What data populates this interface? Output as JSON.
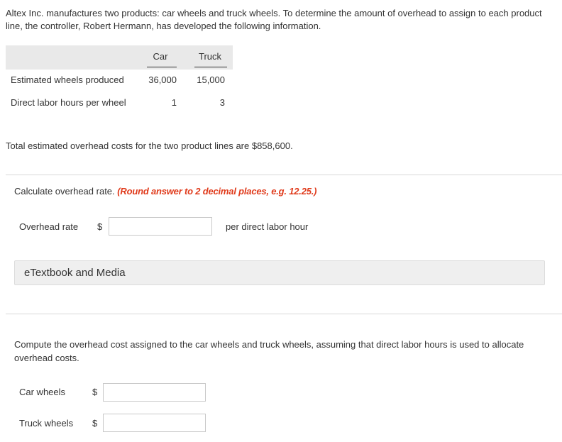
{
  "intro": "Altex Inc. manufactures two products: car wheels and truck wheels. To determine the amount of overhead to assign to each product line, the controller, Robert Hermann, has developed the following information.",
  "table": {
    "headers": [
      "Car",
      "Truck"
    ],
    "rows": [
      {
        "label": "Estimated wheels produced",
        "car": "36,000",
        "truck": "15,000"
      },
      {
        "label": "Direct labor hours per wheel",
        "car": "1",
        "truck": "3"
      }
    ]
  },
  "total_text": "Total estimated overhead costs for the two product lines are $858,600.",
  "question1": {
    "prompt": "Calculate overhead rate.",
    "hint": "(Round answer to 2 decimal places, e.g. 12.25.)",
    "label": "Overhead rate",
    "currency": "$",
    "value": "",
    "suffix": "per direct labor hour"
  },
  "etextbook_label": "eTextbook and Media",
  "question2": {
    "prompt": "Compute the overhead cost assigned to the car wheels and truck wheels, assuming that direct labor hours is used to allocate overhead costs.",
    "car_label": "Car wheels",
    "truck_label": "Truck wheels",
    "currency": "$",
    "car_value": "",
    "truck_value": ""
  }
}
